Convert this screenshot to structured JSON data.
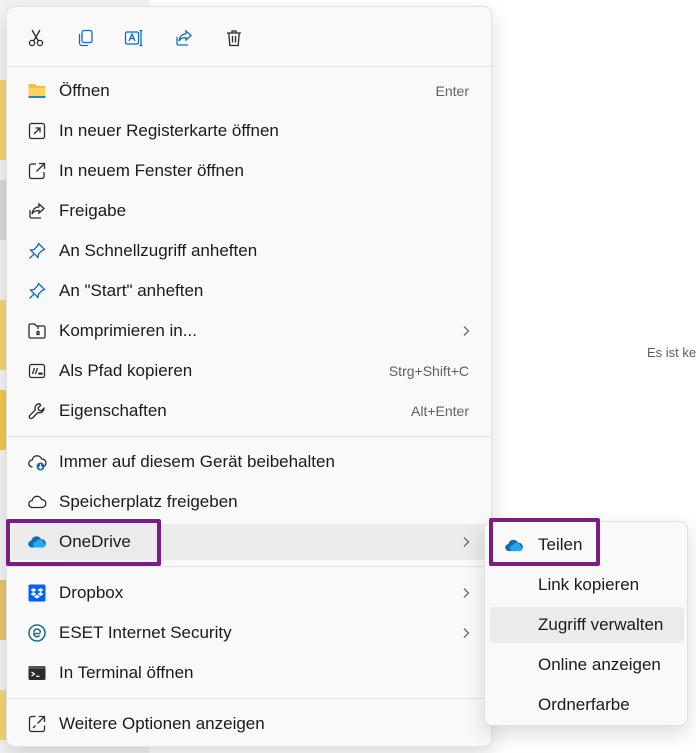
{
  "colors": {
    "accent": "#0f6cbd",
    "highlight": "#7b1d86",
    "menu_bg": "#f9f9f9",
    "hover_bg": "#ebebeb"
  },
  "background": {
    "empty_text": "Es ist ke"
  },
  "toolbar": {
    "items": [
      {
        "name": "cut",
        "icon": "scissors-icon"
      },
      {
        "name": "copy",
        "icon": "copy-icon"
      },
      {
        "name": "rename",
        "icon": "rename-icon"
      },
      {
        "name": "share",
        "icon": "share-icon"
      },
      {
        "name": "delete",
        "icon": "trash-icon"
      }
    ]
  },
  "menu": {
    "items": [
      {
        "label": "Öffnen",
        "shortcut": "Enter",
        "icon": "folder-icon"
      },
      {
        "label": "In neuer Registerkarte öffnen",
        "icon": "open-tab-icon"
      },
      {
        "label": "In neuem Fenster öffnen",
        "icon": "open-window-icon"
      },
      {
        "label": "Freigabe",
        "icon": "share-icon"
      },
      {
        "label": "An Schnellzugriff anheften",
        "icon": "pin-icon"
      },
      {
        "label": "An \"Start\" anheften",
        "icon": "pin-icon"
      },
      {
        "label": "Komprimieren in...",
        "icon": "zip-folder-icon",
        "submenu": true
      },
      {
        "label": "Als Pfad kopieren",
        "shortcut": "Strg+Shift+C",
        "icon": "path-icon"
      },
      {
        "label": "Eigenschaften",
        "shortcut": "Alt+Enter",
        "icon": "wrench-icon"
      },
      {
        "label": "Immer auf diesem Gerät beibehalten",
        "icon": "cloud-download-icon"
      },
      {
        "label": "Speicherplatz freigeben",
        "icon": "cloud-outline-icon"
      },
      {
        "label": "OneDrive",
        "icon": "onedrive-icon",
        "submenu": true
      },
      {
        "label": "Dropbox",
        "icon": "dropbox-icon",
        "submenu": true
      },
      {
        "label": "ESET Internet Security",
        "icon": "eset-icon",
        "submenu": true
      },
      {
        "label": "In Terminal öffnen",
        "icon": "terminal-icon"
      },
      {
        "label": "Weitere Optionen anzeigen",
        "icon": "more-options-icon"
      }
    ]
  },
  "submenu": {
    "items": [
      {
        "label": "Teilen",
        "icon": "onedrive-icon"
      },
      {
        "label": "Link kopieren"
      },
      {
        "label": "Zugriff verwalten"
      },
      {
        "label": "Online anzeigen"
      },
      {
        "label": "Ordnerfarbe"
      }
    ]
  }
}
